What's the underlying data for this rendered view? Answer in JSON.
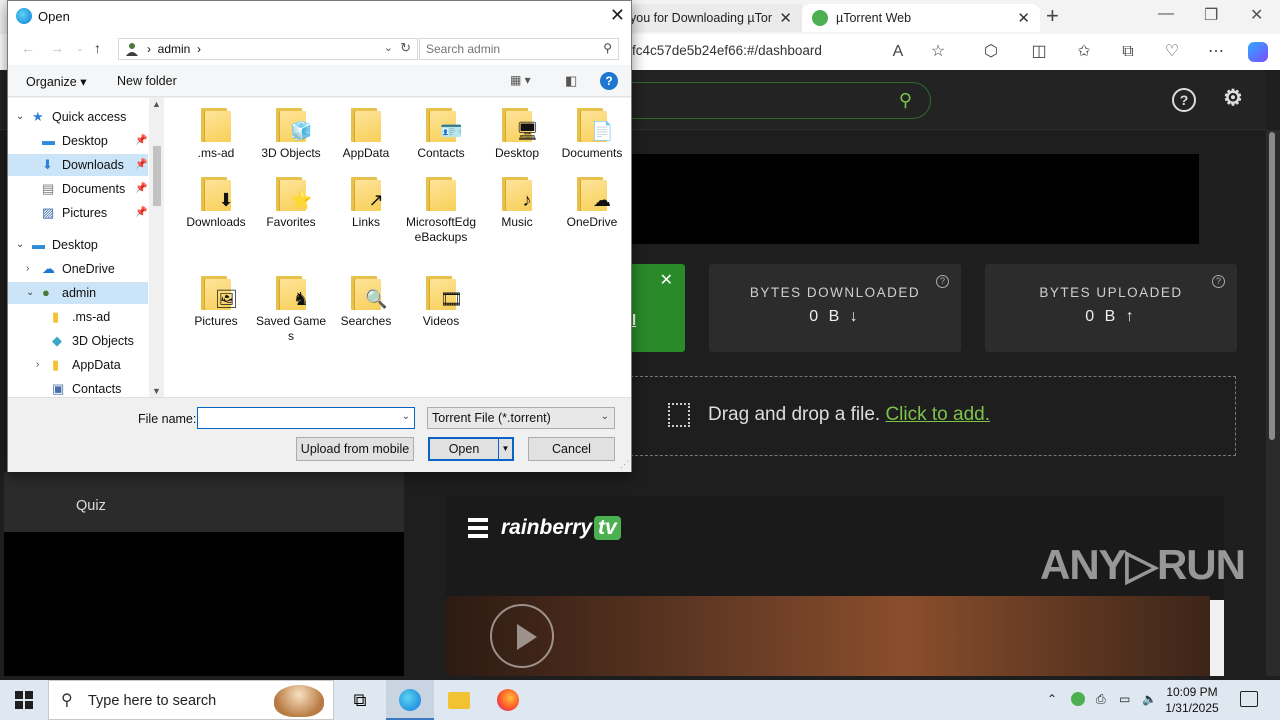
{
  "browser": {
    "tab1_label": "you for Downloading µTor",
    "tab2_label": "µTorrent Web",
    "url": "fc4c57de5b24ef66:#/dashboard",
    "close_glyph": "✕",
    "new_tab_glyph": "+"
  },
  "page": {
    "stats": [
      {
        "title": "BYTES DOWNLOADED",
        "value": "0 B ↓"
      },
      {
        "title": "BYTES UPLOADED",
        "value": "0 B ↑"
      }
    ],
    "green_card_text": "l",
    "dropzone_text": "Drag and drop a file.",
    "dropzone_link": "Click to add.",
    "sidebar_item": "Quiz",
    "brand": "rainberry",
    "brand_tv": "tv",
    "watermark": "ANY▷RUN",
    "help_glyph": "?"
  },
  "dialog": {
    "title": "Open",
    "path_user": "admin",
    "path_sep": "›",
    "search_placeholder": "Search admin",
    "organize_label": "Organize ▾",
    "new_folder_label": "New folder",
    "nav_items": [
      {
        "label": "Quick access",
        "icon": "star-icon"
      },
      {
        "label": "Desktop",
        "icon": "desktop-icon"
      },
      {
        "label": "Downloads",
        "icon": "download-icon"
      },
      {
        "label": "Documents",
        "icon": "documents-icon"
      },
      {
        "label": "Pictures",
        "icon": "pictures-icon"
      },
      {
        "label": "Desktop",
        "icon": "desktop-icon"
      },
      {
        "label": "OneDrive",
        "icon": "cloud-icon"
      },
      {
        "label": "admin",
        "icon": "user-icon"
      },
      {
        "label": ".ms-ad",
        "icon": "folder-icon"
      },
      {
        "label": "3D Objects",
        "icon": "cube-icon"
      },
      {
        "label": "AppData",
        "icon": "folder-icon"
      },
      {
        "label": "Contacts",
        "icon": "contacts-icon"
      }
    ],
    "folders": [
      {
        "label": ".ms-ad",
        "overlay": ""
      },
      {
        "label": "3D Objects",
        "overlay": "🧊"
      },
      {
        "label": "AppData",
        "overlay": ""
      },
      {
        "label": "Contacts",
        "overlay": "🪪"
      },
      {
        "label": "Desktop",
        "overlay": "🖥"
      },
      {
        "label": "Documents",
        "overlay": "📄"
      },
      {
        "label": "Downloads",
        "overlay": "⬇"
      },
      {
        "label": "Favorites",
        "overlay": "⭐"
      },
      {
        "label": "Links",
        "overlay": "↗"
      },
      {
        "label": "MicrosoftEdgeBackups",
        "overlay": ""
      },
      {
        "label": "Music",
        "overlay": "♪"
      },
      {
        "label": "OneDrive",
        "overlay": "☁"
      },
      {
        "label": "Pictures",
        "overlay": "🖼"
      },
      {
        "label": "Saved Games",
        "overlay": "♞"
      },
      {
        "label": "Searches",
        "overlay": "🔍"
      },
      {
        "label": "Videos",
        "overlay": "🎞"
      }
    ],
    "file_name_label": "File name:",
    "file_name_value": "",
    "file_type": "Torrent File (*.torrent)",
    "upload_mobile_label": "Upload from mobile",
    "open_label": "Open",
    "cancel_label": "Cancel",
    "help_glyph": "?"
  },
  "taskbar": {
    "search_text": "Type here to search",
    "time": "10:09 PM",
    "date": "1/31/2025"
  },
  "colors": {
    "accent_green": "#7dc34a",
    "dialog_blue": "#0a64c8"
  }
}
